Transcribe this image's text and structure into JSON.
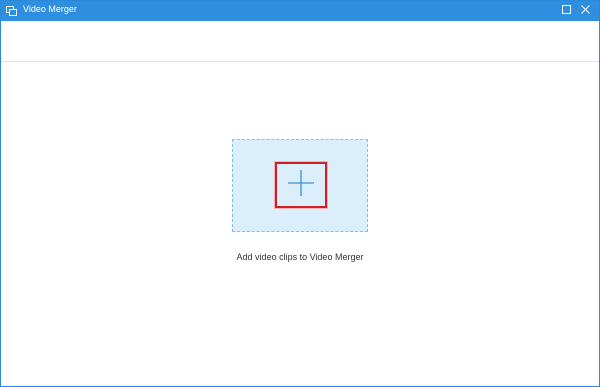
{
  "window": {
    "title": "Video Merger"
  },
  "titlebar": {
    "app_icon": "window-copy-icon",
    "maximize_icon": "maximize-icon",
    "close_icon": "close-icon"
  },
  "main": {
    "add_icon": "plus-icon",
    "caption": "Add video clips to Video Merger"
  },
  "colors": {
    "titlebar": "#2e8fe0",
    "drop_zone_fill": "#dbeefc",
    "drop_zone_border": "#86bfe9",
    "highlight": "#d21f22"
  }
}
